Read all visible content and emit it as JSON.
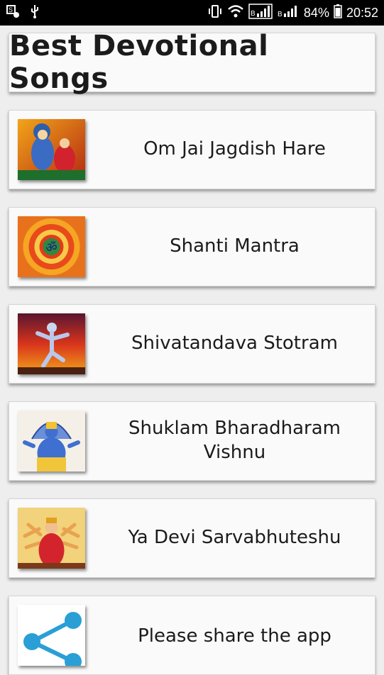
{
  "status_bar": {
    "battery": "84%",
    "time": "20:52",
    "icons": [
      "notification-icon",
      "usb-icon",
      "vibrate-icon",
      "wifi-icon",
      "signal-icon",
      "signal-icon",
      "battery-icon"
    ]
  },
  "header": {
    "title": "Best Devotional Songs"
  },
  "songs": [
    {
      "title": "Om Jai Jagdish Hare",
      "thumb": "vishnu-lakshmi-image"
    },
    {
      "title": "Shanti Mantra",
      "thumb": "om-mandala-image"
    },
    {
      "title": "Shivatandava Stotram",
      "thumb": "nataraja-shiva-image"
    },
    {
      "title": "Shuklam Bharadharam Vishnu",
      "thumb": "vishnu-image"
    },
    {
      "title": "Ya Devi Sarvabhuteshu",
      "thumb": "durga-devi-image"
    },
    {
      "title": "Please share the app",
      "thumb": "share-icon"
    }
  ]
}
